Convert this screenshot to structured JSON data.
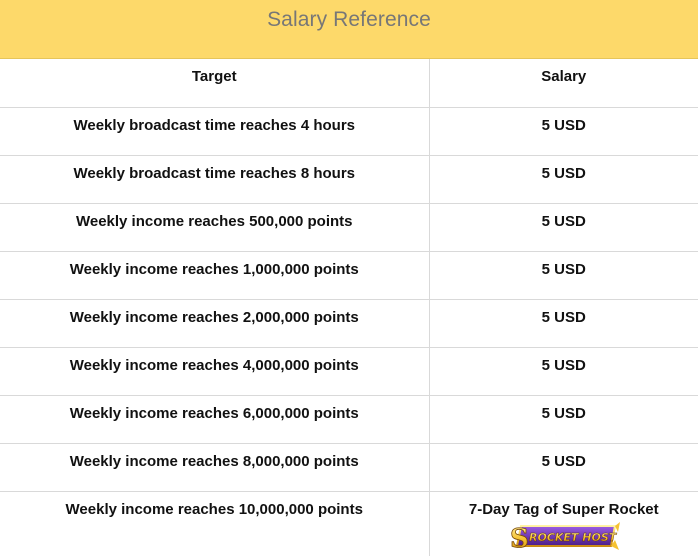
{
  "title": "Salary Reference",
  "columns": {
    "target": "Target",
    "salary": "Salary"
  },
  "rows": [
    {
      "target": "Weekly broadcast time reaches 4 hours",
      "salary": "5 USD"
    },
    {
      "target": "Weekly broadcast time reaches 8 hours",
      "salary": "5 USD"
    },
    {
      "target": "Weekly income reaches 500,000 points",
      "salary": "5 USD"
    },
    {
      "target": "Weekly income reaches 1,000,000 points",
      "salary": "5 USD"
    },
    {
      "target": "Weekly income reaches 2,000,000 points",
      "salary": "5 USD"
    },
    {
      "target": "Weekly income reaches 4,000,000 points",
      "salary": "5 USD"
    },
    {
      "target": "Weekly income reaches 6,000,000 points",
      "salary": "5 USD"
    },
    {
      "target": "Weekly income reaches 8,000,000 points",
      "salary": "5 USD"
    },
    {
      "target": "Weekly income reaches 10,000,000 points",
      "salary": "7-Day Tag of Super Rocket",
      "badge_text": "ROCKET HOST",
      "badge_initial": "S"
    }
  ],
  "colors": {
    "header_bg": "#fdd96a",
    "title_text": "#777777",
    "grid": "#d9d9d9",
    "badge_purple": "#6b2fa8",
    "badge_gold": "#f6c231"
  }
}
